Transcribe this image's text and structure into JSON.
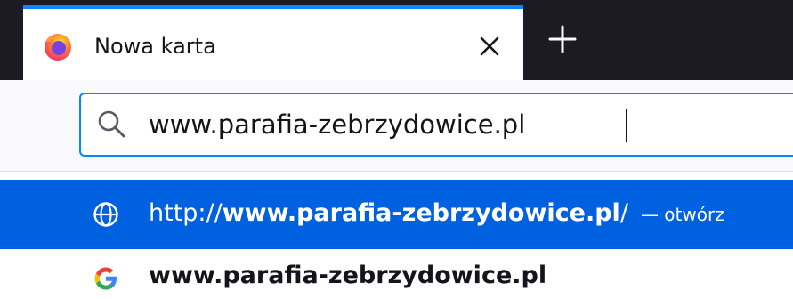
{
  "tab": {
    "title": "Nowa karta",
    "favicon": "firefox-logo-icon",
    "close_icon": "close-icon",
    "accent_color": "#0a84ff"
  },
  "toolbar": {
    "new_tab_icon": "plus-icon"
  },
  "urlbar": {
    "icon": "search-icon",
    "value": "www.parafia-zebrzydowice.pl"
  },
  "results": [
    {
      "icon": "globe-icon",
      "selected": true,
      "url_prefix": "http://",
      "url_host": "www.parafia-zebrzydowice.pl",
      "url_suffix": "/",
      "action": "— otwórz"
    },
    {
      "icon": "google-icon",
      "selected": false,
      "text": "www.parafia-zebrzydowice.pl"
    }
  ],
  "colors": {
    "tabstrip_bg": "#1c1b22",
    "selected_row": "#0061e0",
    "focus_ring": "#0a84ff"
  }
}
